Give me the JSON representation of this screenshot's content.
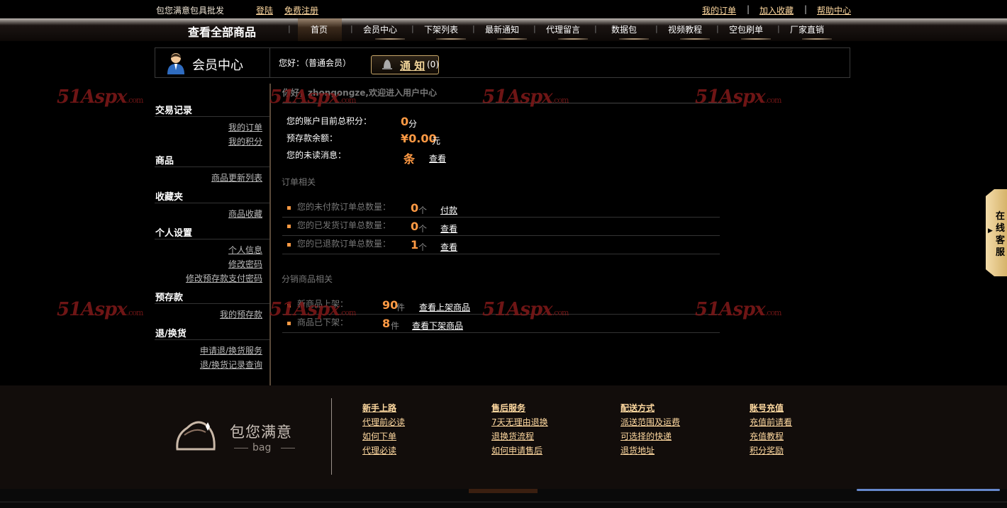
{
  "topbar": {
    "brand": "包您满意包具批发",
    "login": "登陆",
    "register": "免费注册",
    "my_orders": "我的订单",
    "favorite": "加入收藏",
    "help": "帮助中心",
    "separator": "|"
  },
  "nav": {
    "all_products": "查看全部商品",
    "items": [
      "首页",
      "会员中心",
      "下架列表",
      "最新通知",
      "代理留言",
      "数据包",
      "视频教程",
      "空包刷单",
      "厂家直销"
    ]
  },
  "member": {
    "title": "会员中心",
    "hello": "您好：（普通会员）",
    "notice_label": "通 知",
    "notice_count": "(0)"
  },
  "sidebar": {
    "sections": [
      {
        "title": "交易记录",
        "links": [
          "我的订单",
          "我的积分"
        ]
      },
      {
        "title": "商品",
        "links": [
          "商品更新列表"
        ]
      },
      {
        "title": "收藏夹",
        "links": [
          "商品收藏"
        ]
      },
      {
        "title": "个人设置",
        "links": [
          "个人信息",
          "修改密码",
          "修改预存款支付密码"
        ]
      },
      {
        "title": "预存款",
        "links": [
          "我的预存款"
        ]
      },
      {
        "title": "退/换货",
        "links": [
          "申请退/换货服务",
          "退/换货记录查询"
        ]
      }
    ]
  },
  "welcome": "你好，zhongongze,欢迎进入用户中心",
  "account": {
    "points_label": "您的账户目前总积分：",
    "points_value": "0",
    "points_unit": "分",
    "balance_label": "预存款余额：",
    "balance_value": "¥0.00",
    "balance_unit": "元",
    "unread_label": "您的未读消息：",
    "unread_unit": "条",
    "unread_link": "查看"
  },
  "orders": {
    "section_title": "订单相关",
    "rows": [
      {
        "label": "您的未付款订单总数量：",
        "value": "0",
        "unit": "个",
        "link": "付款"
      },
      {
        "label": "您的已发货订单总数量：",
        "value": "0",
        "unit": "个",
        "link": "查看"
      },
      {
        "label": "您的已退款订单总数量：",
        "value": "1",
        "unit": "个",
        "link": "查看"
      }
    ]
  },
  "distribution": {
    "section_title": "分销商品相关",
    "rows": [
      {
        "label": "新商品上架：",
        "value": "90",
        "unit": "件",
        "link": "查看上架商品"
      },
      {
        "label": "商品已下架：",
        "value": "8",
        "unit": "件",
        "link": "查看下架商品"
      }
    ]
  },
  "watermark": {
    "main": "51Aspx",
    "suffix": ".com"
  },
  "service": {
    "label": "在线客服",
    "arrow": "▶"
  },
  "footer": {
    "logo_text": "包您满意",
    "logo_sub": "bag",
    "columns": [
      {
        "title": "新手上路",
        "links": [
          "代理前必读",
          "如何下单",
          "代理必读"
        ]
      },
      {
        "title": "售后服务",
        "links": [
          "7天无理由退换",
          "退换货流程",
          "如何申请售后"
        ]
      },
      {
        "title": "配送方式",
        "links": [
          "派送范围及运费",
          "可选择的快递",
          "退货地址"
        ]
      },
      {
        "title": "账号充值",
        "links": [
          "充值前请看",
          "充值教程",
          "积分奖励"
        ]
      }
    ]
  },
  "colors": {
    "accent": "#ff9a44",
    "link": "#ffd9a0",
    "watermark": "#7a1818"
  }
}
